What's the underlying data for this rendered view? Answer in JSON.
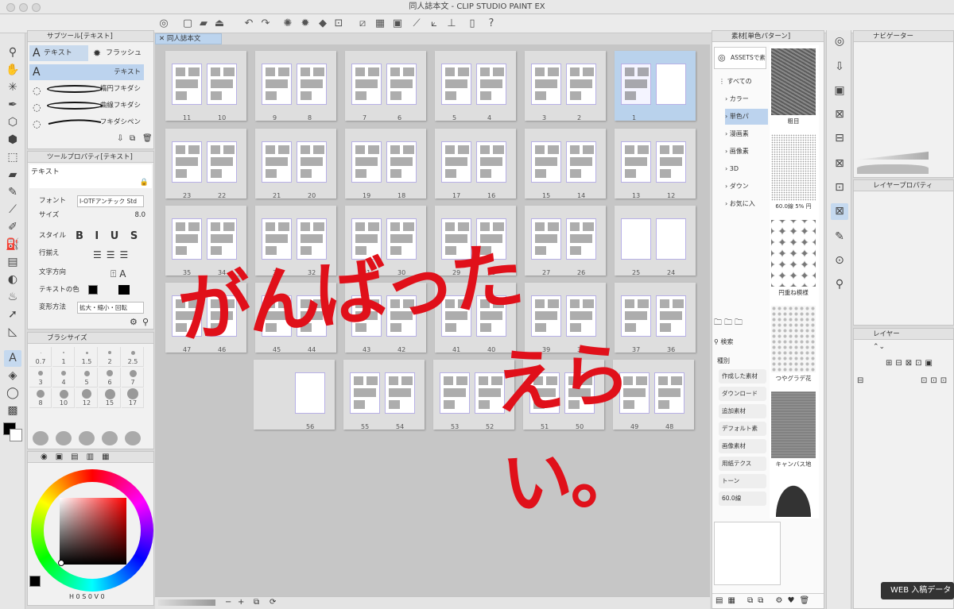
{
  "window": {
    "title": "同人誌本文 - CLIP STUDIO PAINT EX"
  },
  "document_tab": {
    "name": "同人誌本文"
  },
  "subtool": {
    "header": "サブツール[テキスト]",
    "tabs": [
      "テキスト",
      "フラッシュ"
    ],
    "items": [
      "テキスト",
      "楕円フキダシ",
      "曲線フキダシ",
      "フキダシペン"
    ]
  },
  "tool_property": {
    "header": "ツールプロパティ[テキスト]",
    "name": "テキスト",
    "rows": [
      {
        "label": "フォント",
        "value": "I-OTFアンチック Std"
      },
      {
        "label": "サイズ",
        "value": "8.0"
      },
      {
        "label": "スタイル",
        "value": "B I U S"
      },
      {
        "label": "行揃え",
        "value": ""
      },
      {
        "label": "文字方向",
        "value": ""
      },
      {
        "label": "テキストの色",
        "value": ""
      },
      {
        "label": "変形方法",
        "value": "拡大・縮小・回転"
      }
    ]
  },
  "brush_size": {
    "header": "ブラシサイズ",
    "sizes": [
      "0.7",
      "1",
      "1.5",
      "2",
      "2.5",
      "3",
      "4",
      "5",
      "6",
      "7",
      "8",
      "10",
      "12",
      "15",
      "17"
    ]
  },
  "color_wheel": {
    "hsv_readout": "H 0 S 0 V 0"
  },
  "canvas": {
    "rows": [
      [
        [
          "11",
          "10"
        ],
        [
          "9",
          "8"
        ],
        [
          "7",
          "6"
        ],
        [
          "5",
          "4"
        ],
        [
          "3",
          "2"
        ],
        [
          "1",
          ""
        ]
      ],
      [
        [
          "23",
          "22"
        ],
        [
          "21",
          "20"
        ],
        [
          "19",
          "18"
        ],
        [
          "17",
          "16"
        ],
        [
          "15",
          "14"
        ],
        [
          "13",
          "12"
        ]
      ],
      [
        [
          "35",
          "34"
        ],
        [
          "33",
          "32"
        ],
        [
          "31",
          "30"
        ],
        [
          "29",
          "28"
        ],
        [
          "27",
          "26"
        ],
        [
          "25",
          "24"
        ]
      ],
      [
        [
          "47",
          "46"
        ],
        [
          "45",
          "44"
        ],
        [
          "43",
          "42"
        ],
        [
          "41",
          "40"
        ],
        [
          "39",
          "38"
        ],
        [
          "37",
          "36"
        ]
      ],
      [
        [
          "",
          "56"
        ],
        [
          "55",
          "54"
        ],
        [
          "53",
          "52"
        ],
        [
          "51",
          "50"
        ],
        [
          "49",
          "48"
        ]
      ]
    ],
    "scribble_line1": "がんばった",
    "scribble_line2": "えらい。"
  },
  "material": {
    "header": "素材[単色パターン]",
    "assets_label": "ASSETSで素材",
    "tree": [
      "すべての",
      "カラー",
      "単色パ",
      "漫画素",
      "画像素",
      "3D",
      "ダウン",
      "お気に入"
    ],
    "search_label": "検索",
    "kind_label": "種別",
    "filters": [
      "作成した素材",
      "ダウンロード",
      "追加素材",
      "デフォルト素",
      "画像素材",
      "用紙テクス",
      "トーン",
      "60.0線"
    ],
    "thumbs": [
      "粗目",
      "60.0線 5% 円",
      "円重ね模様",
      "つやグラデ花",
      "キャンバス地",
      ""
    ]
  },
  "navigator": {
    "header": "ナビゲーター"
  },
  "layer_property": {
    "header": "レイヤープロパティ"
  },
  "layer": {
    "header": "レイヤー"
  },
  "tooltip": "WEB 入稿データ"
}
